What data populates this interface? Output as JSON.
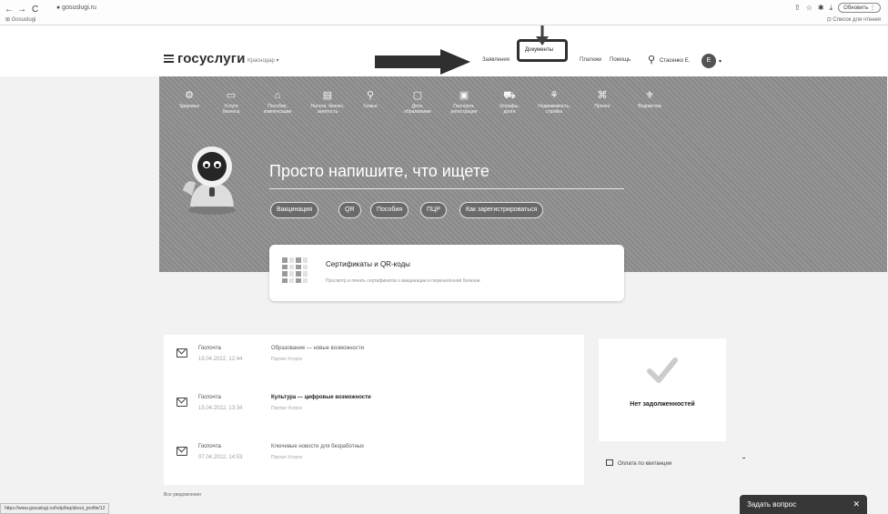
{
  "browser": {
    "back": "←",
    "forward": "→",
    "reload": "C",
    "url": "● gosuslugi.ru",
    "bookmark": "⊞ Gosuslugi",
    "icons": [
      "share-icon",
      "star-icon",
      "extensions-icon",
      "download-icon"
    ],
    "profile": "Обновить ⋮",
    "sub_link": "⊡ Список для чтения"
  },
  "header": {
    "logo": "госуслуги",
    "region": "Краснодар ▾",
    "links": {
      "applications": "Заявления",
      "documents": "Документы",
      "payments": "Платежи",
      "help": "Помощь"
    },
    "user_name": "Стасенко Е.",
    "avatar_initial": "Е",
    "avatar_caret": "▾"
  },
  "categories": [
    {
      "icon": "⚙",
      "label": "Здоровье"
    },
    {
      "icon": "▭",
      "label": "Услуги\nбизнеса"
    },
    {
      "icon": "⌂",
      "label": "Пособия,\nкомпенсации"
    },
    {
      "icon": "▤",
      "label": "Налоги, бизнес,\nзанятость"
    },
    {
      "icon": "⚲",
      "label": "Семья"
    },
    {
      "icon": "▢",
      "label": "Дети,\nобразование"
    },
    {
      "icon": "▣",
      "label": "Паспорта,\nрегистрация"
    },
    {
      "icon": "⛟",
      "label": "Штрафы,\nдолги"
    },
    {
      "icon": "⚘",
      "label": "Недвижимость,\nстройка"
    },
    {
      "icon": "⌘",
      "label": "Прочее"
    },
    {
      "icon": "⚜",
      "label": "Ведомства"
    }
  ],
  "hero": {
    "title": "Просто напишите, что ищете",
    "chips": [
      "Вакцинация",
      "QR",
      "Пособия",
      "ПЦР",
      "Как зарегистрироваться"
    ]
  },
  "cert_card": {
    "title": "Сертификаты и QR-коды",
    "description": "Просмотр и печать сертификатов о вакцинации и перенесённой болезни"
  },
  "messages": [
    {
      "kind": "Госпочта",
      "date": "19.04.2022, 12:44",
      "title": "Образование — новые возможности",
      "source": "Портал Услуги",
      "bold": false
    },
    {
      "kind": "Госпочта",
      "date": "15.04.2022, 13:34",
      "title": "Культура — цифровые возможности",
      "source": "Портал Услуги",
      "bold": true
    },
    {
      "kind": "Госпочта",
      "date": "07.04.2022, 14:53",
      "title": "Ключевые новости для безработных",
      "source": "Портал Услуги",
      "bold": false
    }
  ],
  "all_messages": "Все уведомления",
  "debts": {
    "text": "Нет задолженностей",
    "pay_link": "Оплата по квитанции"
  },
  "status_bar": "https://www.gosuslugi.ru/help/faq/about_profile/12",
  "ask": {
    "label": "Задать вопрос",
    "close": "✕"
  },
  "colors": {
    "hero_bg": "#8f8f8f",
    "chip_bg": "#6b6b6b",
    "ask_bg": "#3a3a3a",
    "annotation": "#333333"
  }
}
